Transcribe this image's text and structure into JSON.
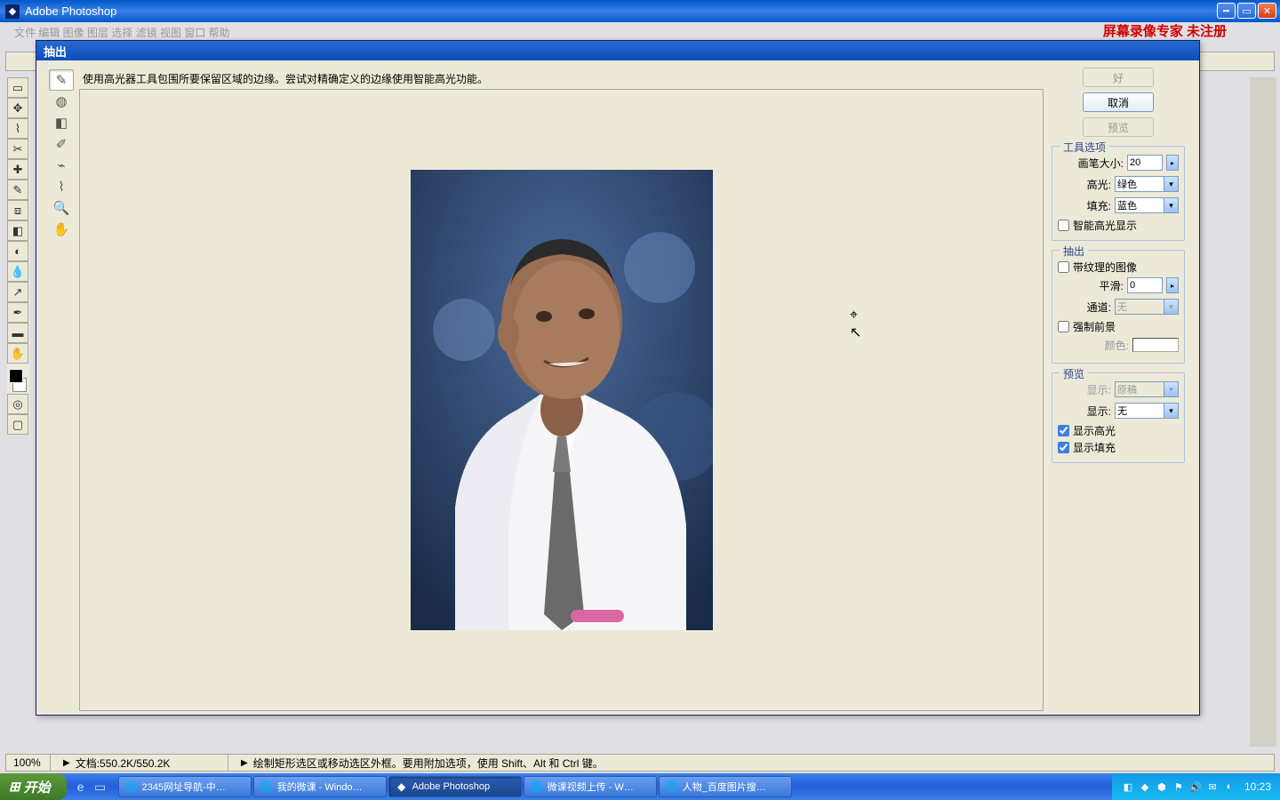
{
  "app": {
    "title": "Adobe Photoshop"
  },
  "watermark": "屏幕录像专家  未注册",
  "mainMenuStub": "文件   编辑   图像   图层   选择   滤镜   视图   窗口   帮助",
  "statusbar": {
    "zoom": "100%",
    "doc": "文档:550.2K/550.2K",
    "hint": "绘制矩形选区或移动选区外框。要用附加选项，使用 Shift、Alt 和 Ctrl 键。"
  },
  "dialog": {
    "title": "抽出",
    "hint": "使用高光器工具包围所要保留区域的边缘。尝试对精确定义的边缘使用智能高光功能。",
    "buttons": {
      "ok": "好",
      "cancel": "取消",
      "preview": "预览"
    },
    "toolOptions": {
      "title": "工具选项",
      "brushSizeLabel": "画笔大小:",
      "brushSizeValue": "20",
      "highlightLabel": "高光:",
      "highlightValue": "绿色",
      "fillLabel": "填充:",
      "fillValue": "蓝色",
      "smartHighlight": "智能高光显示"
    },
    "extract": {
      "title": "抽出",
      "textured": "带纹理的图像",
      "smoothLabel": "平滑:",
      "smoothValue": "0",
      "channelLabel": "通道:",
      "channelValue": "无",
      "forceFG": "强制前景",
      "colorLabel": "颜色:"
    },
    "preview": {
      "title": "预览",
      "viewLabel": "显示:",
      "viewOriginal": "原稿",
      "showLabel": "显示:",
      "showValue": "无",
      "showHighlight": "显示高光",
      "showFill": "显示填充"
    }
  },
  "taskbar": {
    "start": "开始",
    "items": [
      {
        "label": "2345网址导航-中…",
        "icon": "🌐"
      },
      {
        "label": "我的微课 - Windo…",
        "icon": "🌐"
      },
      {
        "label": "Adobe Photoshop",
        "icon": "◆",
        "active": true
      },
      {
        "label": "微课视频上传 - W…",
        "icon": "🌐"
      },
      {
        "label": "人物_百度图片搜…",
        "icon": "🌐"
      }
    ],
    "clock": "10:23"
  }
}
